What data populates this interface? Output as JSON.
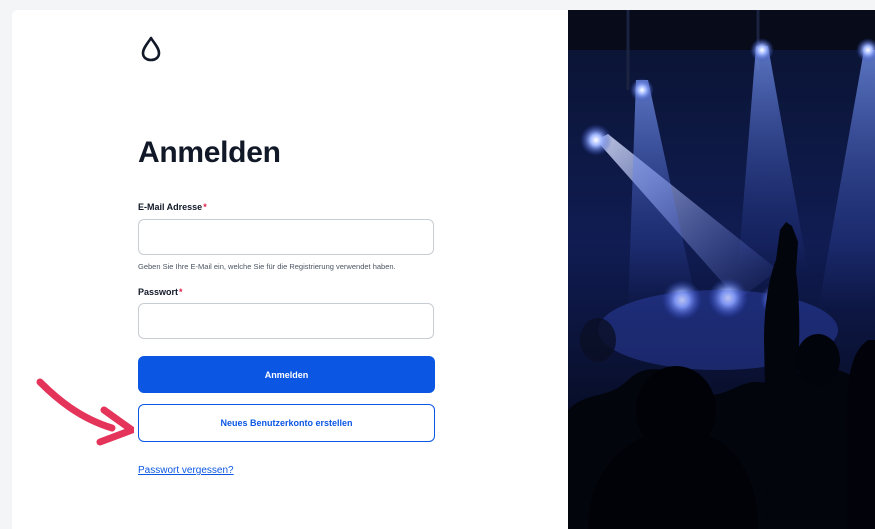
{
  "page": {
    "title": "Anmelden"
  },
  "form": {
    "email_label": "E-Mail Adresse",
    "email_required": "*",
    "email_hint": "Geben Sie Ihre E-Mail ein, welche Sie für die Registrierung verwendet haben.",
    "password_label": "Passwort",
    "password_required": "*",
    "email_value": "",
    "password_value": ""
  },
  "actions": {
    "login_label": "Anmelden",
    "register_label": "Neues Benutzerkonto erstellen",
    "forgot_label": "Passwort vergessen?"
  },
  "icons": {
    "logo": "droplet-logo-icon",
    "annotation": "red-arrow-icon"
  },
  "colors": {
    "primary": "#0b57e3",
    "text": "#111827",
    "required": "#e11d48",
    "annotation": "#e5345a"
  }
}
